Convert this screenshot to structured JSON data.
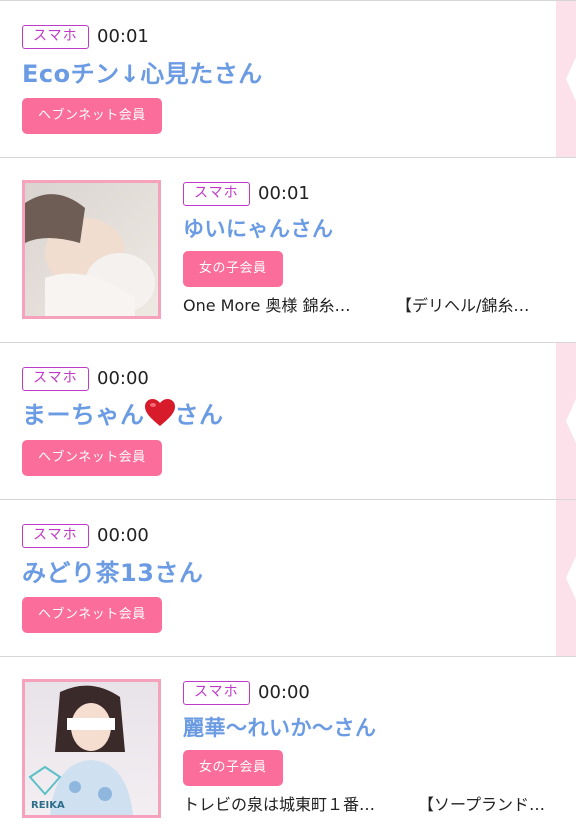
{
  "entries": [
    {
      "device": "スマホ",
      "time": "00:01",
      "name": "Ecoチン↓心見たさん",
      "member_type": "ヘブンネット会員"
    },
    {
      "device": "スマホ",
      "time": "00:01",
      "name": "ゆいにゃんさん",
      "member_type": "女の子会員",
      "shop": "One More 奥様 錦糸…",
      "genre": "【デリヘル/錦糸…",
      "photo_icon": "girl-photo-icon"
    },
    {
      "device": "スマホ",
      "time": "00:00",
      "name_before": "まーちゃん",
      "name_icon": "heart-icon",
      "name_after": "さん",
      "member_type": "ヘブンネット会員"
    },
    {
      "device": "スマホ",
      "time": "00:00",
      "name": "みどり茶13さん",
      "member_type": "ヘブンネット会員"
    },
    {
      "device": "スマホ",
      "time": "00:00",
      "name": "麗華〜れいか〜さん",
      "member_type": "女の子会員",
      "shop": "トレビの泉は城東町１番…",
      "genre": "【ソープランド…",
      "photo_icon": "girl-photo-icon",
      "photo_caption": "REIKA"
    }
  ],
  "colors": {
    "accent_name": "#6b9be3",
    "badge_pink": "#fb6d9a",
    "device_border": "#c03ac9",
    "rail_pink": "#fde1ea"
  }
}
